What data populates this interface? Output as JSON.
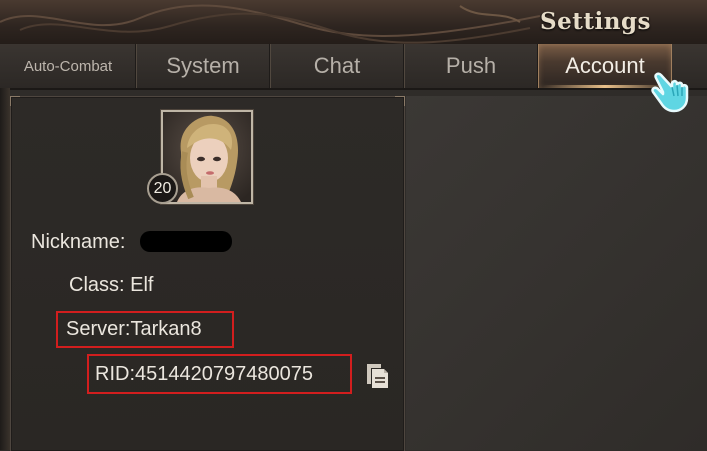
{
  "header": {
    "title": "Settings"
  },
  "tabs": [
    {
      "label": "Auto-Combat",
      "active": false
    },
    {
      "label": "System",
      "active": false
    },
    {
      "label": "Chat",
      "active": false
    },
    {
      "label": "Push",
      "active": false
    },
    {
      "label": "Account",
      "active": true
    }
  ],
  "profile": {
    "level": "20",
    "nickname_label": "Nickname:",
    "class_text": "Class: Elf",
    "server_text": "Server:Tarkan8",
    "rid_text": "RID:4514420797480075"
  },
  "icons": {
    "copy": "copy-icon",
    "pointer": "pointing-hand-icon"
  },
  "colors": {
    "highlight": "#d21e1e",
    "active_tab": "#7a5d46",
    "pointer_hand": "#4fd3e0"
  }
}
